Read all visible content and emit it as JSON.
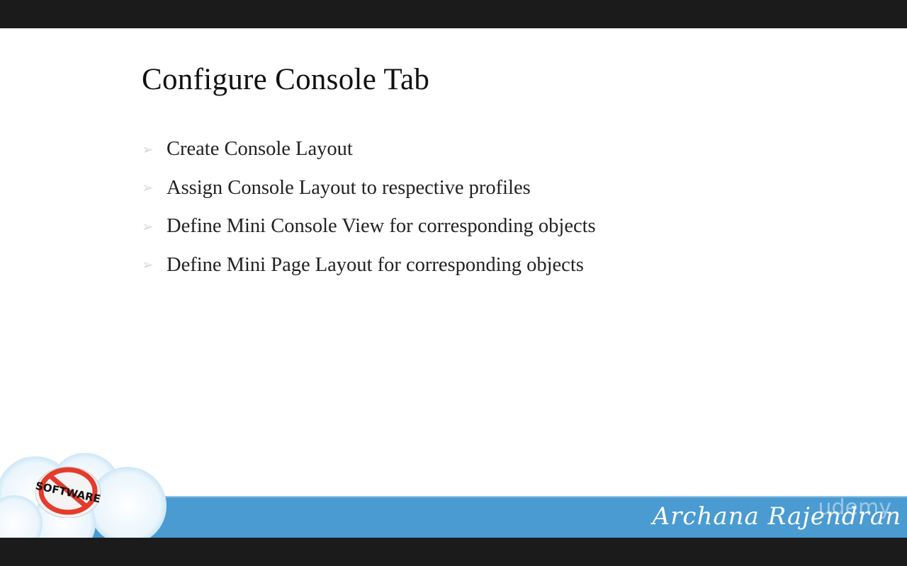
{
  "slide": {
    "title": "Configure Console Tab",
    "bullets": [
      "Create Console Layout",
      "Assign Console Layout to respective profiles",
      "Define Mini Console View for corresponding objects",
      "Define Mini Page Layout for corresponding objects"
    ],
    "bullet_icon": "arrow-bullet-icon",
    "logo_text": "SOFTWARE",
    "signature": "Archana Rajendran",
    "watermark": "udemy",
    "colors": {
      "band": "#4a9bd1",
      "letterbox": "#1b1b1b"
    }
  }
}
